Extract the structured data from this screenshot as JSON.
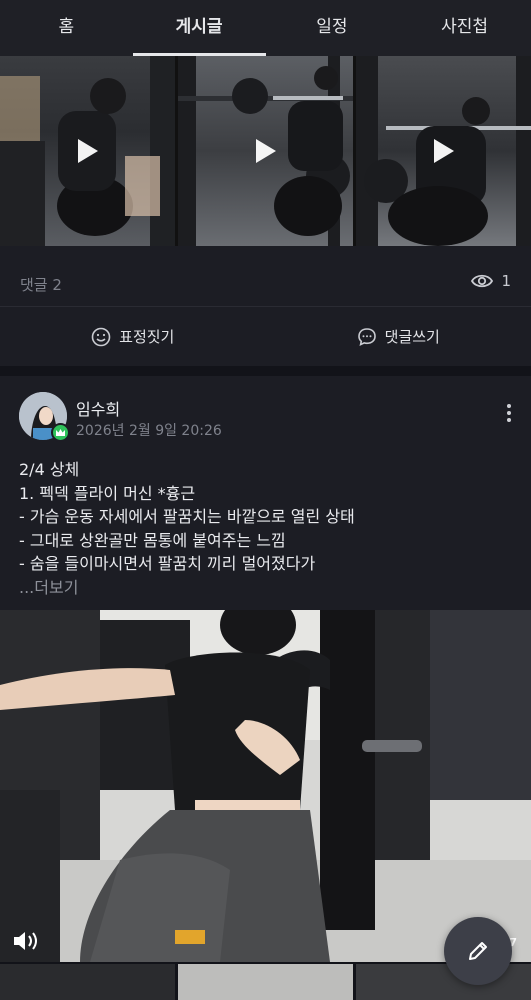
{
  "tabs": [
    {
      "label": "홈",
      "active": false
    },
    {
      "label": "게시글",
      "active": true
    },
    {
      "label": "일정",
      "active": false
    },
    {
      "label": "사진첩",
      "active": false
    }
  ],
  "post1": {
    "media": [
      {
        "type": "video",
        "icon": "play-icon"
      },
      {
        "type": "video",
        "icon": "play-icon"
      },
      {
        "type": "video",
        "icon": "play-icon"
      }
    ],
    "comments_label": "댓글 2",
    "views": "1",
    "react_label": "표정짓기",
    "comment_label": "댓글쓰기"
  },
  "post2": {
    "author": "임수희",
    "date": "2026년 2월 9일 20:26",
    "lines": [
      "2/4 상체",
      "1. 펙덱 플라이 머신 *흉근",
      "- 가슴 운동 자세에서 팔꿈치는 바깥으로 열린 상태",
      "- 그대로 상완골만 몸통에 붙여주는 느낌",
      "- 숨을 들이마시면서 팔꿈치 끼리 멀어졌다가"
    ],
    "see_more": "...더보기",
    "media_count": "7"
  },
  "colors": {
    "background": "#121319",
    "card": "#1c1d24",
    "tabbar": "#1f2026",
    "muted": "#7f828c",
    "badge": "#2fc25b"
  }
}
